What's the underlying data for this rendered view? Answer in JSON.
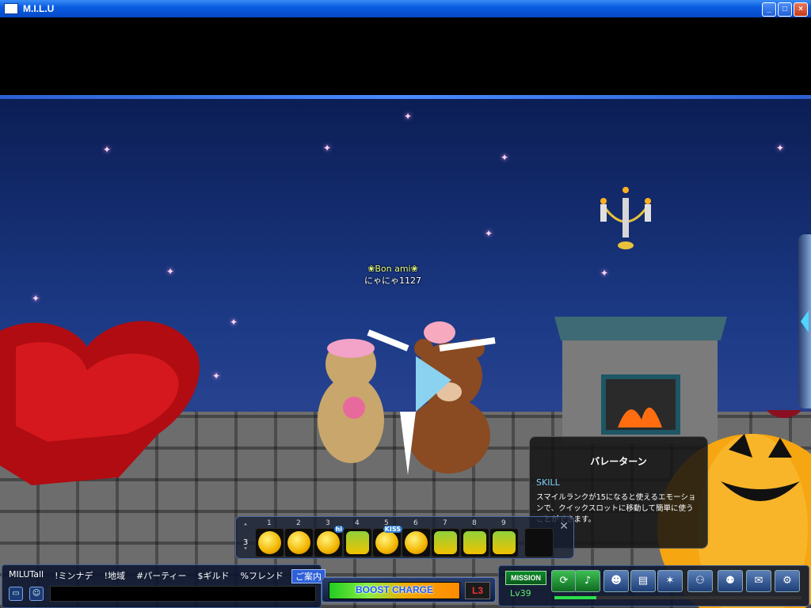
{
  "window": {
    "title": "M.I.L.U",
    "buttons": [
      "minimize",
      "maximize",
      "close"
    ]
  },
  "character": {
    "guild": "❀Bon ami❀",
    "name": "にゃにゃ1127"
  },
  "tooltip": {
    "title": "バレーターン",
    "type": "SKILL",
    "description": "スマイルランクが15になると使えるエモーションで、クイックスロットに移動して簡単に使うことができます。"
  },
  "quickslot": {
    "page": "3",
    "slots": [
      {
        "key": "1",
        "icon": "laugh-emote-icon"
      },
      {
        "key": "2",
        "icon": "cry-emote-icon"
      },
      {
        "key": "3",
        "icon": "hi-emote-icon",
        "badge": "hi"
      },
      {
        "key": "4",
        "icon": "ballet-turn-emote-icon"
      },
      {
        "key": "5",
        "icon": "kiss-emote-icon",
        "badge": "KISS"
      },
      {
        "key": "6",
        "icon": "cheer-emote-icon"
      },
      {
        "key": "7",
        "icon": "dance-emote-icon"
      },
      {
        "key": "8",
        "icon": "jump-emote-icon"
      },
      {
        "key": "9",
        "icon": "pose-emote-icon"
      },
      {
        "key": "",
        "icon": "empty-slot"
      }
    ]
  },
  "chat": {
    "tabs": [
      "MILUTall",
      "!ミンナデ",
      "!地域",
      "#パーティー",
      "$ギルド",
      "%フレンド",
      "ご案内"
    ],
    "active_tab": "ご案内"
  },
  "boost": {
    "label": "BOOST CHARGE",
    "level": "L3"
  },
  "menu": {
    "mission_label": "MISSION",
    "level": "Lv39",
    "exp_fraction": 0.17,
    "icons": [
      "cycle-icon",
      "dance-icon",
      "character-icon",
      "inventory-icon",
      "skill-icon",
      "party-icon",
      "community-icon",
      "chat-icon",
      "settings-icon"
    ]
  },
  "colors": {
    "titlebar": "#0a5ce0",
    "sky": "#1c3a86",
    "accent": "#2d5fd8"
  }
}
